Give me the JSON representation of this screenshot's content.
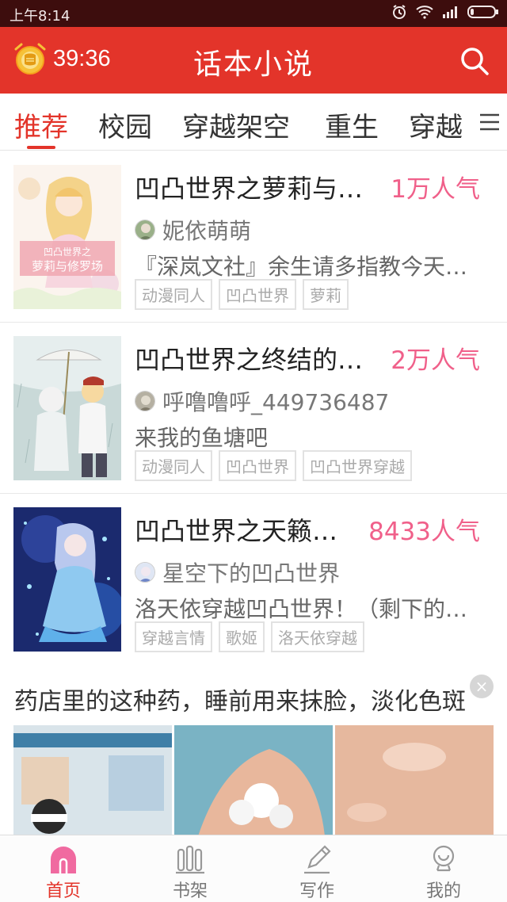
{
  "status_bar": {
    "time": "上午8:14"
  },
  "header": {
    "timer": "39:36",
    "title": "话本小说"
  },
  "tabs": [
    "推荐",
    "校园",
    "穿越架空",
    "重生",
    "穿越"
  ],
  "books": [
    {
      "title": "凹凸世界之萝莉与…",
      "popularity": "1万人气",
      "author": "妮依萌萌",
      "desc": "『深岚文社』余生请多指教今天…",
      "tags": [
        "动漫同人",
        "凹凸世界",
        "萝莉"
      ],
      "cover_text": "凹凸世界之萝莉与修罗场"
    },
    {
      "title": "凹凸世界之终结的…",
      "popularity": "2万人气",
      "author": "呼噜噜呼_449736487",
      "desc": "来我的鱼塘吧",
      "tags": [
        "动漫同人",
        "凹凸世界",
        "凹凸世界穿越"
      ]
    },
    {
      "title": "凹凸世界之天籁…",
      "popularity": "8433人气",
      "author": "星空下的凹凸世界",
      "desc": "洛天依穿越凹凸世界！（剩下的…",
      "tags": [
        "穿越言情",
        "歌姬",
        "洛天依穿越"
      ]
    }
  ],
  "ad": {
    "text": "药店里的这种药，睡前用来抹脸，淡化色斑",
    "close": "×"
  },
  "bottom_nav": [
    {
      "label": "首页",
      "icon": "home-icon"
    },
    {
      "label": "书架",
      "icon": "bookshelf-icon"
    },
    {
      "label": "写作",
      "icon": "pen-icon"
    },
    {
      "label": "我的",
      "icon": "profile-icon"
    }
  ],
  "colors": {
    "primary": "#e3342a",
    "popularity": "#f0608a",
    "status_bar": "#3d0d0d"
  }
}
